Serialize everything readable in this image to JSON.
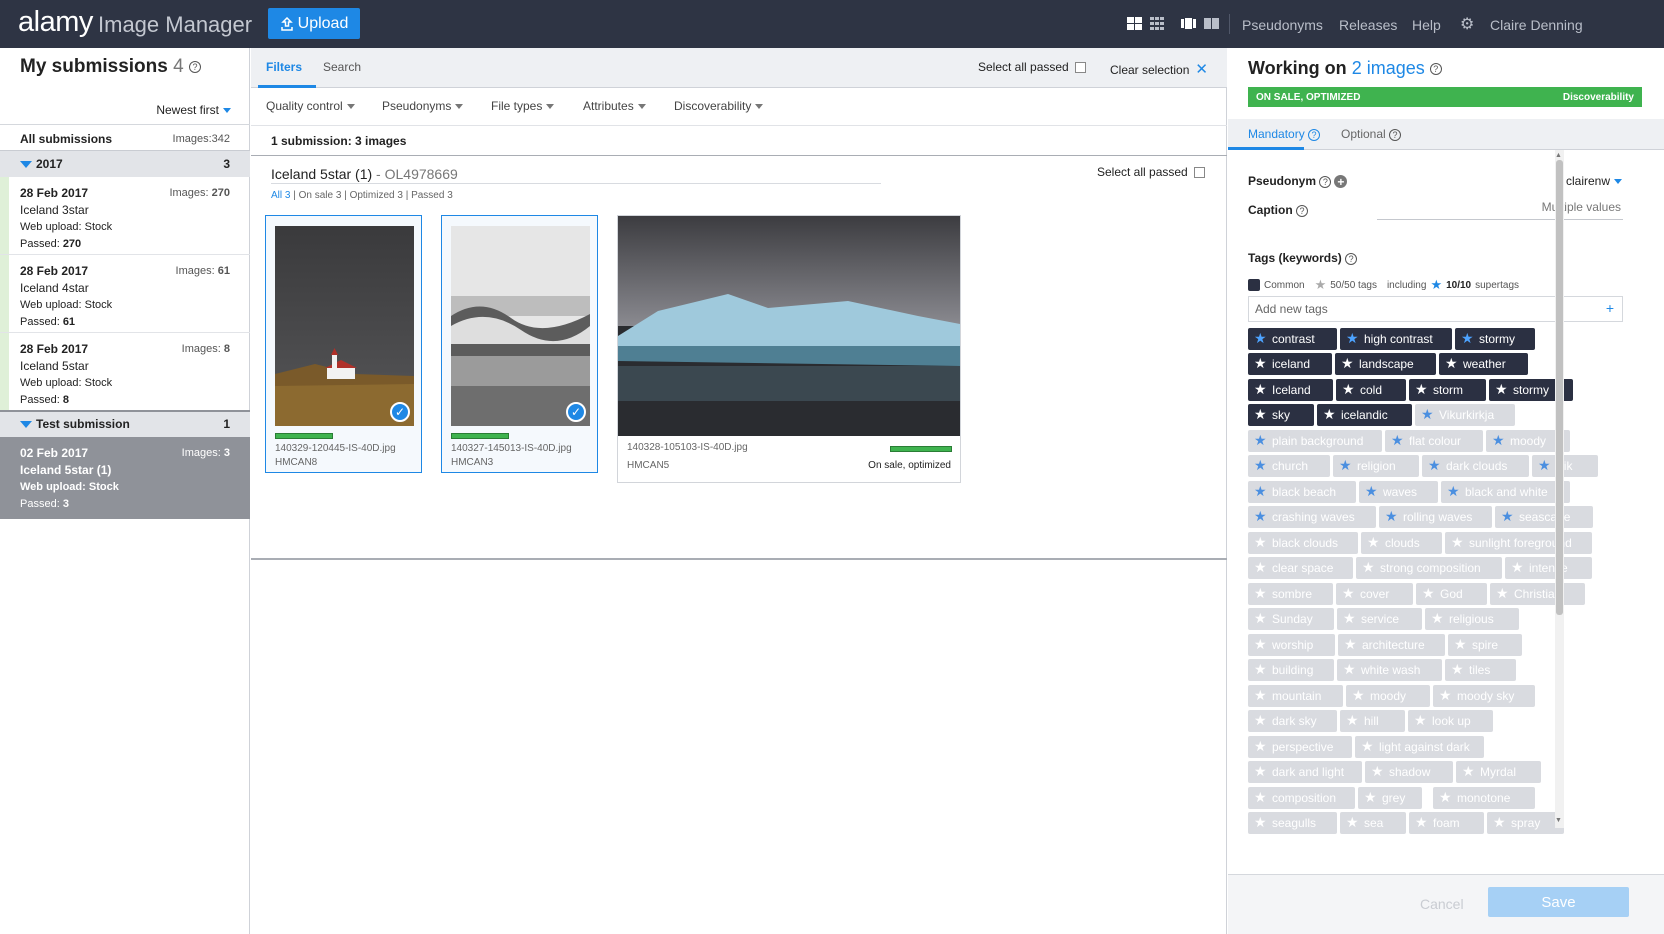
{
  "topbar": {
    "logo": "alamy",
    "logo_sub": "Image Manager",
    "upload_label": "Upload",
    "links": [
      "Pseudonyms",
      "Releases",
      "Help"
    ],
    "user": "Claire Denning"
  },
  "left": {
    "title": "My submissions",
    "count": "4",
    "sort_label": "Newest first",
    "all": {
      "label": "All submissions",
      "images": "Images:342"
    },
    "groups": [
      {
        "label": "2017",
        "count": "3"
      },
      {
        "label": "Test submission",
        "count": "1"
      }
    ],
    "items": [
      {
        "date": "28 Feb 2017",
        "images_label": "Images:",
        "images": "270",
        "name": "Iceland 3star",
        "upload_label": "Web upload:",
        "upload": "Stock",
        "passed_label": "Passed:",
        "passed": "270"
      },
      {
        "date": "28 Feb 2017",
        "images_label": "Images:",
        "images": "61",
        "name": "Iceland 4star",
        "upload_label": "Web upload:",
        "upload": "Stock",
        "passed_label": "Passed:",
        "passed": "61"
      },
      {
        "date": "28 Feb 2017",
        "images_label": "Images:",
        "images": "8",
        "name": "Iceland 5star",
        "upload_label": "Web upload:",
        "upload": "Stock",
        "passed_label": "Passed:",
        "passed": "8"
      },
      {
        "date": "02 Feb 2017",
        "images_label": "Images:",
        "images": "3",
        "name": "Iceland 5star (1)",
        "upload_label": "Web upload:",
        "upload": "Stock",
        "passed_label": "Passed:",
        "passed": "3"
      }
    ]
  },
  "middle": {
    "tabs": [
      "Filters",
      "Search"
    ],
    "select_all_passed": "Select all passed",
    "clear_selection": "Clear selection",
    "filters": [
      "Quality control",
      "Pseudonyms",
      "File types",
      "Attributes",
      "Discoverability"
    ],
    "count_text": "1 submission: 3 images",
    "submission_title": "Iceland 5star (1)",
    "submission_id": " - OL4978669",
    "sub_links": {
      "all": "All 3",
      "rest": " | On sale 3 | Optimized 3 | Passed 3"
    },
    "images": [
      {
        "file": "140329-120445-IS-40D.jpg",
        "code": "HMCAN8"
      },
      {
        "file": "140327-145013-IS-40D.jpg",
        "code": "HMCAN3"
      },
      {
        "file": "140328-105103-IS-40D.jpg",
        "code": "HMCAN5",
        "status": "On sale, optimized"
      }
    ]
  },
  "right": {
    "title": "Working on",
    "count_text": "2 images",
    "status_left": "ON SALE, OPTIMIZED",
    "status_right": "Discoverability",
    "tabs": [
      "Mandatory",
      "Optional"
    ],
    "pseudonym_label": "Pseudonym",
    "pseudonym_value": "clairenw",
    "caption_label": "Caption",
    "caption_value": "Multiple values",
    "tags_label": "Tags (keywords)",
    "legend": {
      "common": "Common",
      "tags": "50/50 tags",
      "including": "including",
      "super": "10/10",
      "super_label": "supertags"
    },
    "add_tags_placeholder": "Add new tags",
    "tags": [
      "contrast",
      "high contrast",
      "stormy",
      "iceland",
      "landscape",
      "weather",
      "Iceland",
      "cold",
      "storm",
      "stormy",
      "sky",
      "icelandic",
      "Vikurkirkja",
      "plain background",
      "flat colour",
      "moody",
      "church",
      "religion",
      "dark clouds",
      "Vik",
      "black beach",
      "waves",
      "black and white",
      "crashing waves",
      "rolling waves",
      "seascape",
      "black clouds",
      "clouds",
      "sunlight foreground",
      "clear space",
      "strong composition",
      "intense",
      "sombre",
      "cover",
      "God",
      "Christian",
      "Sunday",
      "service",
      "religious",
      "worship",
      "architecture",
      "spire",
      "building",
      "white wash",
      "tiles",
      "mountain",
      "moody",
      "moody sky",
      "dark sky",
      "hill",
      "look up",
      "perspective",
      "light against dark",
      "dark and light",
      "shadow",
      "Myrdal",
      "composition",
      "grey",
      "monotone",
      "seagulls",
      "sea",
      "foam",
      "spray"
    ],
    "cancel": "Cancel",
    "save": "Save"
  },
  "colors": {
    "topbar": "#2e3444",
    "accent": "#1e88e5",
    "success": "#3fb34f",
    "tag_dark": "#2b3042",
    "tag_light": "#d9dbe0"
  }
}
